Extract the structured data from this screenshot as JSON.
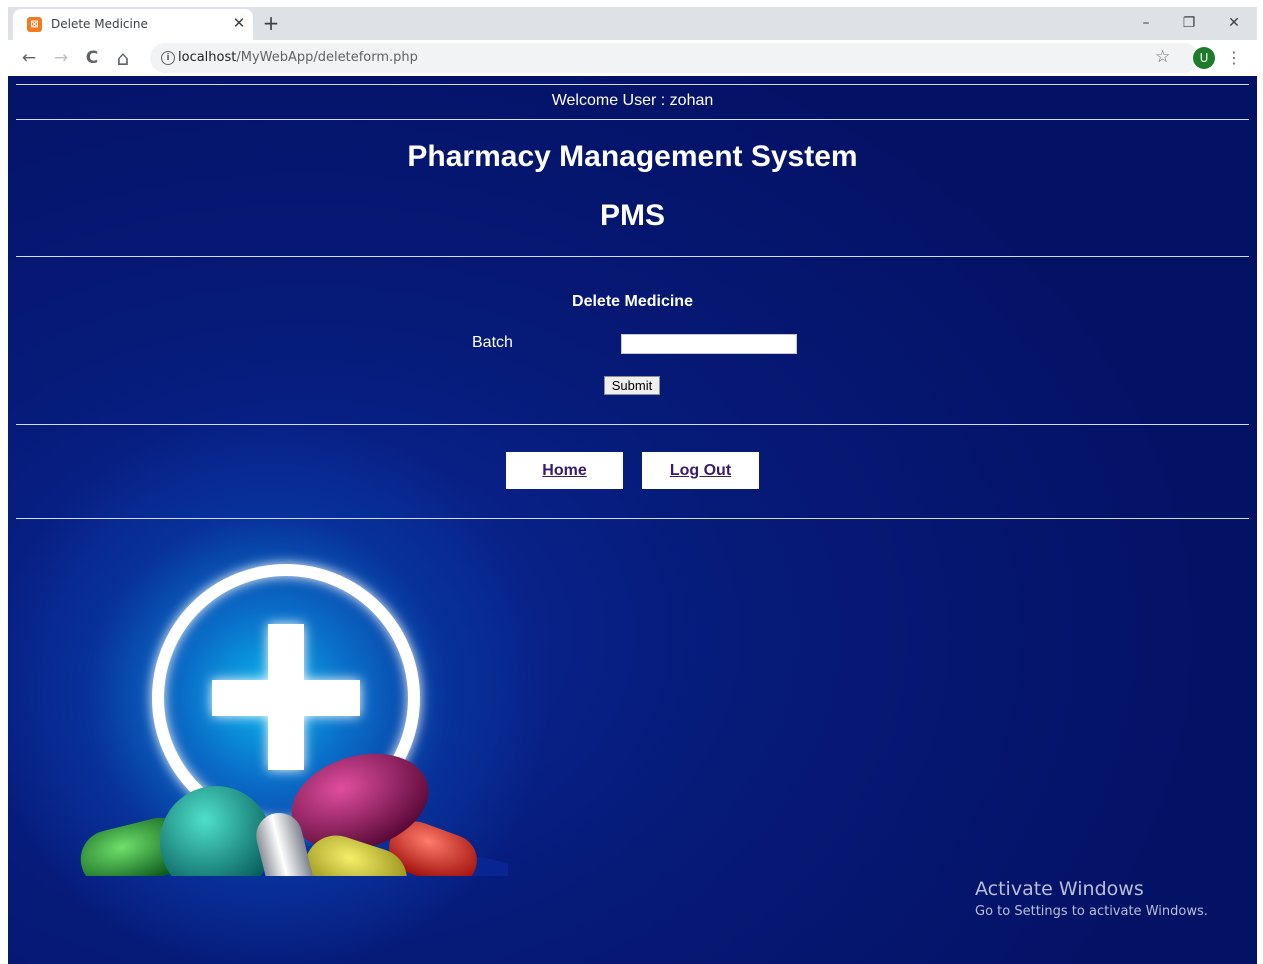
{
  "browser": {
    "tab_title": "Delete Medicine",
    "tab_close": "✕",
    "new_tab": "+",
    "window_controls": {
      "minimize": "–",
      "restore": "❐",
      "close": "✕"
    },
    "nav": {
      "back": "←",
      "forward": "→",
      "reload": "C",
      "home": "⌂"
    },
    "url_host": "localhost",
    "url_path": "/MyWebApp/deleteform.php",
    "bookmark_star": "☆",
    "profile_initial": "U",
    "menu_dots": "⋮",
    "icons": [
      "xampp-favicon",
      "info-icon",
      "star-icon",
      "profile-avatar",
      "kebab-menu-icon"
    ]
  },
  "header": {
    "welcome": "Welcome User : zohan",
    "title": "Pharmacy Management System",
    "subtitle": "PMS"
  },
  "form": {
    "title": "Delete Medicine",
    "batch_label": "Batch",
    "batch_value": "",
    "submit_label": "Submit"
  },
  "nav_links": {
    "home": "Home",
    "logout": "Log Out"
  },
  "watermark": {
    "line1": "Activate Windows",
    "line2": "Go to Settings to activate Windows."
  },
  "colors": {
    "page_bg": "#041266",
    "glow": "#0bb6ee",
    "link": "#3a1b6b",
    "separator": "#d6dcef"
  }
}
